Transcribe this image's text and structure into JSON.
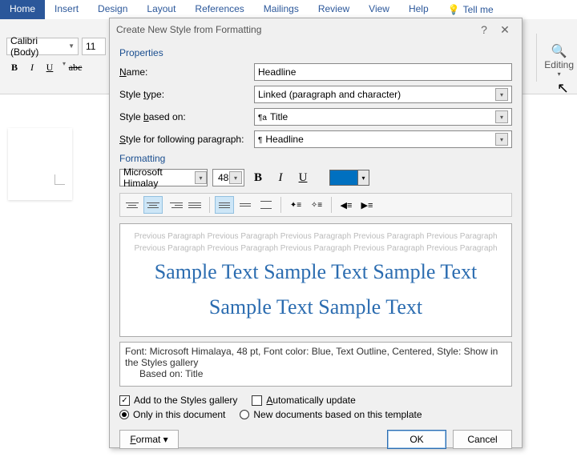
{
  "ribbon": {
    "tabs": [
      "Home",
      "Insert",
      "Design",
      "Layout",
      "References",
      "Mailings",
      "Review",
      "View",
      "Help",
      "Tell me"
    ],
    "font_name": "Calibri (Body)",
    "font_size": "11",
    "editing_label": "Editing"
  },
  "dialog": {
    "title": "Create New Style from Formatting",
    "sections": {
      "properties": "Properties",
      "formatting": "Formatting"
    },
    "labels": {
      "name": "Name:",
      "style_type": "Style type:",
      "style_based_on": "Style based on:",
      "style_following": "Style for following paragraph:"
    },
    "values": {
      "name": "Headline",
      "style_type": "Linked (paragraph and character)",
      "based_on": "Title",
      "following": "Headline"
    },
    "formatting_bar": {
      "font": "Microsoft Himalay",
      "size": "48",
      "color": "#0070c0"
    },
    "preview": {
      "prev_para": "Previous Paragraph Previous Paragraph Previous Paragraph Previous Paragraph Previous Paragraph Previous Paragraph Previous Paragraph Previous Paragraph Previous Paragraph Previous Paragraph",
      "sample": "Sample Text Sample Text Sample Text Sample Text Sample Text"
    },
    "description": {
      "line1": "Font: Microsoft Himalaya, 48 pt, Font color: Blue, Text Outline, Centered, Style: Show in the Styles gallery",
      "line2": "Based on: Title"
    },
    "checkboxes": {
      "add_gallery": "Add to the Styles gallery",
      "auto_update": "Automatically update"
    },
    "radios": {
      "only_doc": "Only in this document",
      "new_docs": "New documents based on this template"
    },
    "buttons": {
      "format": "Format",
      "ok": "OK",
      "cancel": "Cancel"
    }
  }
}
